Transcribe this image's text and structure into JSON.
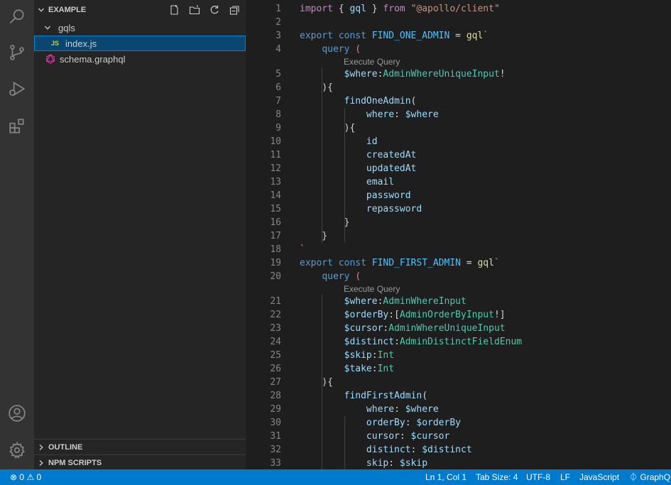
{
  "sidebar": {
    "title": "EXAMPLE",
    "tree": [
      {
        "label": "gqls",
        "type": "folder"
      },
      {
        "label": "index.js",
        "type": "js",
        "icon_text": "JS"
      },
      {
        "label": "schema.graphql",
        "type": "graphql"
      }
    ],
    "panels": [
      "OUTLINE",
      "NPM SCRIPTS"
    ]
  },
  "editor": {
    "codelens": "Execute Query",
    "lines": [
      {
        "n": "1",
        "tokens": [
          [
            "k",
            "import"
          ],
          [
            "p",
            " { "
          ],
          [
            "v",
            "gql"
          ],
          [
            "p",
            " } "
          ],
          [
            "k",
            "from"
          ],
          [
            "p",
            " "
          ],
          [
            "s",
            "\"@apollo/client\""
          ]
        ]
      },
      {
        "n": "2",
        "tokens": []
      },
      {
        "n": "3",
        "tokens": [
          [
            "kw",
            "export"
          ],
          [
            "p",
            " "
          ],
          [
            "kw",
            "const"
          ],
          [
            "p",
            " "
          ],
          [
            "c",
            "FIND_ONE_ADMIN"
          ],
          [
            "p",
            " = "
          ],
          [
            "f",
            "gql"
          ],
          [
            "s",
            "`"
          ]
        ]
      },
      {
        "n": "4",
        "tokens": [
          [
            "p",
            "    "
          ],
          [
            "kw",
            "query"
          ],
          [
            "s",
            " ("
          ]
        ]
      },
      {
        "n": "5",
        "lens": true,
        "tokens": [
          [
            "p",
            "        "
          ],
          [
            "v",
            "$where"
          ],
          [
            "p",
            ":"
          ],
          [
            "t",
            "AdminWhereUniqueInput"
          ],
          [
            "p",
            "!"
          ]
        ]
      },
      {
        "n": "6",
        "tokens": [
          [
            "p",
            "    ){"
          ]
        ]
      },
      {
        "n": "7",
        "tokens": [
          [
            "p",
            "        "
          ],
          [
            "v",
            "findOneAdmin"
          ],
          [
            "p",
            "("
          ]
        ]
      },
      {
        "n": "8",
        "tokens": [
          [
            "p",
            "            "
          ],
          [
            "v",
            "where"
          ],
          [
            "p",
            ": "
          ],
          [
            "v",
            "$where"
          ]
        ]
      },
      {
        "n": "9",
        "tokens": [
          [
            "p",
            "        ){"
          ]
        ]
      },
      {
        "n": "10",
        "tokens": [
          [
            "p",
            "            "
          ],
          [
            "v",
            "id"
          ]
        ]
      },
      {
        "n": "11",
        "tokens": [
          [
            "p",
            "            "
          ],
          [
            "v",
            "createdAt"
          ]
        ]
      },
      {
        "n": "12",
        "tokens": [
          [
            "p",
            "            "
          ],
          [
            "v",
            "updatedAt"
          ]
        ]
      },
      {
        "n": "13",
        "tokens": [
          [
            "p",
            "            "
          ],
          [
            "v",
            "email"
          ]
        ]
      },
      {
        "n": "14",
        "tokens": [
          [
            "p",
            "            "
          ],
          [
            "v",
            "password"
          ]
        ]
      },
      {
        "n": "15",
        "tokens": [
          [
            "p",
            "            "
          ],
          [
            "v",
            "repassword"
          ]
        ]
      },
      {
        "n": "16",
        "tokens": [
          [
            "p",
            "        }"
          ]
        ]
      },
      {
        "n": "17",
        "tokens": [
          [
            "p",
            "    }"
          ]
        ]
      },
      {
        "n": "18",
        "tokens": [
          [
            "s",
            "`"
          ]
        ]
      },
      {
        "n": "19",
        "tokens": [
          [
            "kw",
            "export"
          ],
          [
            "p",
            " "
          ],
          [
            "kw",
            "const"
          ],
          [
            "p",
            " "
          ],
          [
            "c",
            "FIND_FIRST_ADMIN"
          ],
          [
            "p",
            " = "
          ],
          [
            "f",
            "gql"
          ],
          [
            "s",
            "`"
          ]
        ]
      },
      {
        "n": "20",
        "tokens": [
          [
            "p",
            "    "
          ],
          [
            "kw",
            "query"
          ],
          [
            "s",
            " ("
          ]
        ]
      },
      {
        "n": "21",
        "lens": true,
        "tokens": [
          [
            "p",
            "        "
          ],
          [
            "v",
            "$where"
          ],
          [
            "p",
            ":"
          ],
          [
            "t",
            "AdminWhereInput"
          ]
        ]
      },
      {
        "n": "22",
        "tokens": [
          [
            "p",
            "        "
          ],
          [
            "v",
            "$orderBy"
          ],
          [
            "p",
            ":["
          ],
          [
            "t",
            "AdminOrderByInput"
          ],
          [
            "p",
            "!]"
          ]
        ]
      },
      {
        "n": "23",
        "tokens": [
          [
            "p",
            "        "
          ],
          [
            "v",
            "$cursor"
          ],
          [
            "p",
            ":"
          ],
          [
            "t",
            "AdminWhereUniqueInput"
          ]
        ]
      },
      {
        "n": "24",
        "tokens": [
          [
            "p",
            "        "
          ],
          [
            "v",
            "$distinct"
          ],
          [
            "p",
            ":"
          ],
          [
            "t",
            "AdminDistinctFieldEnum"
          ]
        ]
      },
      {
        "n": "25",
        "tokens": [
          [
            "p",
            "        "
          ],
          [
            "v",
            "$skip"
          ],
          [
            "p",
            ":"
          ],
          [
            "t",
            "Int"
          ]
        ]
      },
      {
        "n": "26",
        "tokens": [
          [
            "p",
            "        "
          ],
          [
            "v",
            "$take"
          ],
          [
            "p",
            ":"
          ],
          [
            "t",
            "Int"
          ]
        ]
      },
      {
        "n": "27",
        "tokens": [
          [
            "p",
            "    ){"
          ]
        ]
      },
      {
        "n": "28",
        "tokens": [
          [
            "p",
            "        "
          ],
          [
            "v",
            "findFirstAdmin"
          ],
          [
            "p",
            "("
          ]
        ]
      },
      {
        "n": "29",
        "tokens": [
          [
            "p",
            "            "
          ],
          [
            "v",
            "where"
          ],
          [
            "p",
            ": "
          ],
          [
            "v",
            "$where"
          ]
        ]
      },
      {
        "n": "30",
        "tokens": [
          [
            "p",
            "            "
          ],
          [
            "v",
            "orderBy"
          ],
          [
            "p",
            ": "
          ],
          [
            "v",
            "$orderBy"
          ]
        ]
      },
      {
        "n": "31",
        "tokens": [
          [
            "p",
            "            "
          ],
          [
            "v",
            "cursor"
          ],
          [
            "p",
            ": "
          ],
          [
            "v",
            "$cursor"
          ]
        ]
      },
      {
        "n": "32",
        "tokens": [
          [
            "p",
            "            "
          ],
          [
            "v",
            "distinct"
          ],
          [
            "p",
            ": "
          ],
          [
            "v",
            "$distinct"
          ]
        ]
      },
      {
        "n": "33",
        "tokens": [
          [
            "p",
            "            "
          ],
          [
            "v",
            "skip"
          ],
          [
            "p",
            ": "
          ],
          [
            "v",
            "$skip"
          ]
        ]
      }
    ]
  },
  "statusbar": {
    "errors": "0",
    "warnings": "0",
    "position": "Ln 1, Col 1",
    "tab_size": "Tab Size: 4",
    "encoding": "UTF-8",
    "eol": "LF",
    "language": "JavaScript",
    "graphql": "GraphQL"
  }
}
